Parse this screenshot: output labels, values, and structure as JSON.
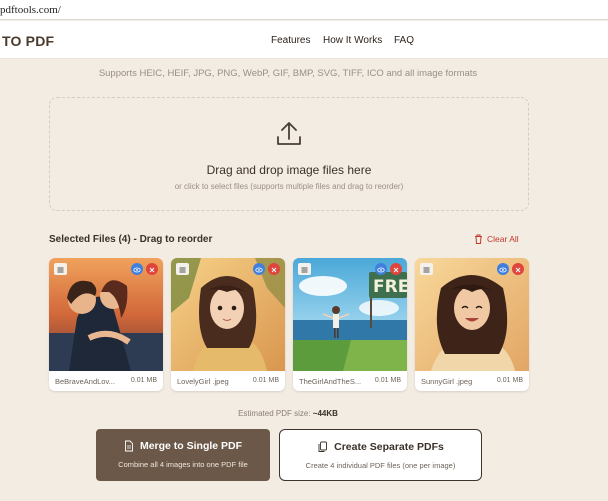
{
  "browser": {
    "url": "pdftools.com/"
  },
  "header": {
    "logo": "TO PDF",
    "nav": [
      {
        "label": "Features"
      },
      {
        "label": "How It Works"
      },
      {
        "label": "FAQ"
      }
    ]
  },
  "subtitle": "Supports HEIC, HEIF, JPG, PNG, WebP, GIF, BMP, SVG, TIFF, ICO and all image formats",
  "dropzone": {
    "title": "Drag and drop image files here",
    "subtitle": "or click to select files (supports multiple files and drag to reorder)",
    "icon": "upload-icon"
  },
  "files": {
    "title": "Selected Files (4) - Drag to reorder",
    "clear_label": "Clear All",
    "items": [
      {
        "name": "BeBraveAndLov...",
        "size": "0.01 MB"
      },
      {
        "name": "LovelyGirl .jpeg",
        "size": "0.01 MB"
      },
      {
        "name": "TheGirlAndTheS...",
        "size": "0.01 MB"
      },
      {
        "name": "SunnyGirl .jpeg",
        "size": "0.01 MB"
      }
    ]
  },
  "estimate": {
    "label": "Estimated PDF size:",
    "value": "~44KB"
  },
  "actions": {
    "merge": {
      "title": "Merge to Single PDF",
      "subtitle": "Combine all 4 images into one PDF file"
    },
    "separate": {
      "title": "Create Separate PDFs",
      "subtitle": "Create 4 individual PDF files (one per image)"
    }
  },
  "colors": {
    "background": "#f3ece3",
    "primary_button": "#6b5848",
    "danger": "#e0453b",
    "view": "#3f7fe0"
  }
}
